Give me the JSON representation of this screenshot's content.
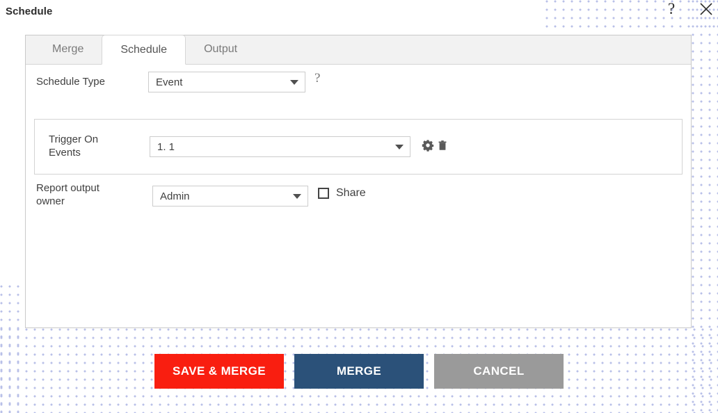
{
  "window": {
    "title": "Schedule",
    "help_icon": "question-mark-icon",
    "help_glyph": "?",
    "close_icon": "close-icon"
  },
  "tabs": [
    {
      "label": "Merge",
      "active": false
    },
    {
      "label": "Schedule",
      "active": true
    },
    {
      "label": "Output",
      "active": false
    }
  ],
  "form": {
    "schedule_type": {
      "label": "Schedule Type",
      "value": "Event",
      "help_glyph": "?"
    },
    "trigger": {
      "label": "Trigger On Events",
      "label_line1": "Trigger On",
      "label_line2": "Events",
      "value": "1. 1",
      "actions": [
        {
          "name": "settings-gear-icon",
          "title": "Settings"
        },
        {
          "name": "delete-trash-icon",
          "title": "Delete"
        }
      ]
    },
    "owner": {
      "label": "Report output owner",
      "label_line1": "Report output",
      "label_line2": "owner",
      "value": "Admin",
      "share_label": "Share",
      "share_checked": false
    }
  },
  "footer": {
    "save_merge_label": "SAVE & MERGE",
    "merge_label": "MERGE",
    "cancel_label": "CANCEL"
  },
  "colors": {
    "save_merge": "#f91e10",
    "merge": "#2b5179",
    "cancel": "#9a9a9a",
    "panel_border": "#c9c9c9",
    "tab_strip": "#f2f2f2",
    "dot_pattern": "#b9c0e8"
  }
}
